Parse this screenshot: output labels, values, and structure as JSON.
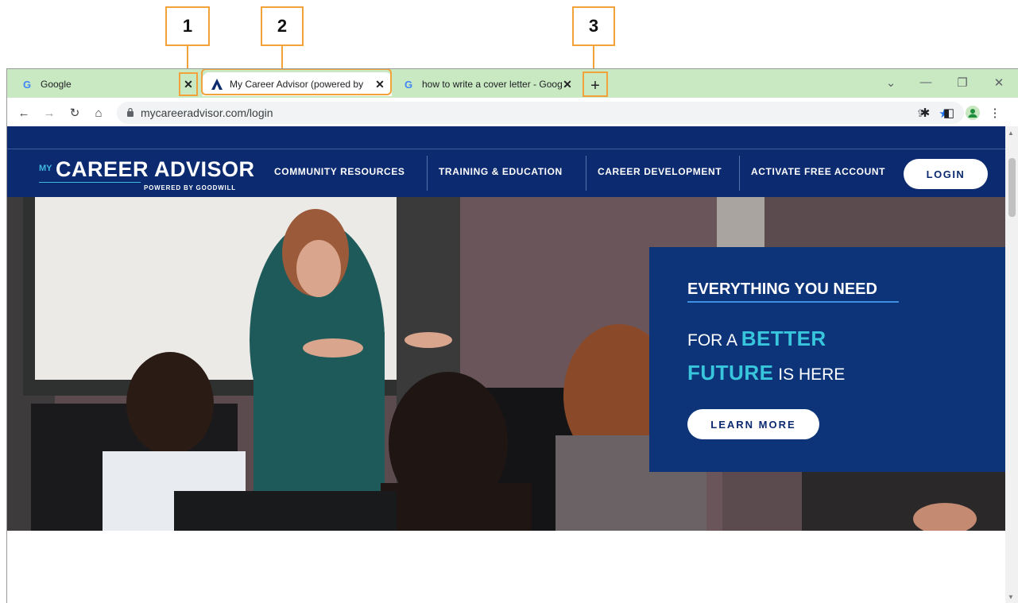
{
  "annotations": {
    "callout_1": "1",
    "callout_2": "2",
    "callout_3": "3",
    "highlight_color": "#f2a23a"
  },
  "browser": {
    "tabs": [
      {
        "title": "Google",
        "favicon": "google-g-icon"
      },
      {
        "title": "My Career Advisor (powered by Goodwill)",
        "favicon": "career-advisor-logo-icon"
      },
      {
        "title": "how to write a cover letter - Google Search",
        "favicon": "google-g-icon"
      }
    ],
    "url": "mycareeradvisor.com/login",
    "tabstrip_color": "#c9e9c3",
    "icons": {
      "close": "✕",
      "new_tab": "+",
      "dropdown": "⌄",
      "minimize": "—",
      "restore": "❐",
      "window_close": "✕",
      "back": "←",
      "forward": "→",
      "reload": "↻",
      "home": "⌂",
      "lock": "🔒",
      "share": "⇪",
      "star": "★",
      "extensions": "✱",
      "side_panel": "◧",
      "profile": "●",
      "menu": "⋮"
    }
  },
  "site": {
    "logo": {
      "prefix": "MY",
      "name": "CAREER ADVISOR",
      "tagline": "POWERED BY GOODWILL"
    },
    "nav": [
      "COMMUNITY RESOURCES",
      "TRAINING & EDUCATION",
      "CAREER DEVELOPMENT",
      "ACTIVATE FREE ACCOUNT"
    ],
    "login_label": "LOGIN",
    "brand_navy": "#0b2a6f",
    "accent_teal": "#38c6dd",
    "hero": {
      "headline": "EVERYTHING YOU NEED",
      "line2_prefix": "FOR A",
      "line2_accent": "BETTER",
      "line3_accent": "FUTURE",
      "line3_suffix": "IS HERE",
      "cta": "LEARN MORE"
    }
  }
}
